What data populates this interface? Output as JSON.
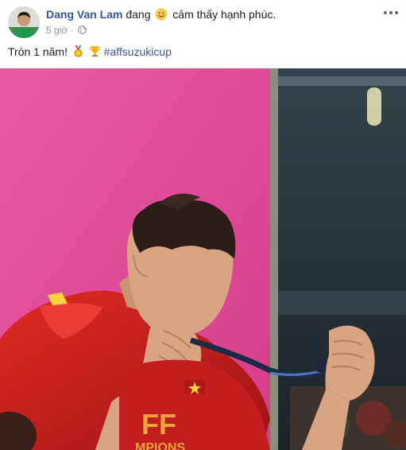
{
  "post": {
    "author_name": "Dang Van Lam",
    "verb_text": "đang",
    "feeling_text": "cảm thấy hạnh phúc.",
    "timestamp": "5 giờ",
    "separator": "·",
    "body_text": "Tròn 1 năm!",
    "hashtag": "#affsuzukicup"
  },
  "photo": {
    "jersey_text_line1": "FF",
    "jersey_text_line2": "MPIONS"
  },
  "icons": {
    "feeling": "smiley-icon",
    "privacy": "globe-icon",
    "emoji_1": "medal-icon",
    "emoji_2": "trophy-icon",
    "menu": "more-options-icon"
  },
  "colors": {
    "author_link": "#365899",
    "meta_gray": "#90949c",
    "background_pink": "#e0509a",
    "jersey_red": "#c41d1d"
  }
}
